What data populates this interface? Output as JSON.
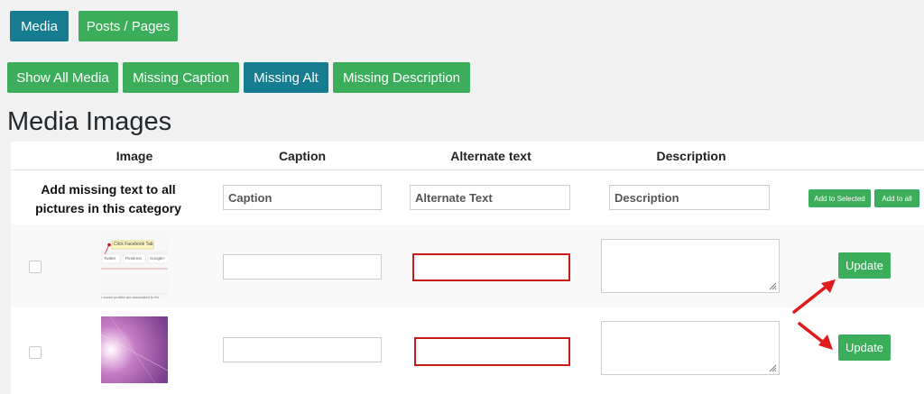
{
  "top_tabs": {
    "media": "Media",
    "posts_pages": "Posts / Pages"
  },
  "filters": {
    "show_all": "Show All Media",
    "missing_caption": "Missing Caption",
    "missing_alt": "Missing Alt",
    "missing_description": "Missing Description"
  },
  "page_title": "Media Images",
  "table": {
    "headers": {
      "image": "Image",
      "caption": "Caption",
      "alt_text": "Alternate text",
      "description": "Description"
    },
    "bulk": {
      "label": "Add missing text to all pictures in this category",
      "caption_placeholder": "Caption",
      "alt_placeholder": "Alternate Text",
      "description_placeholder": "Description",
      "add_selected": "Add to Selected",
      "add_all": "Add to all"
    },
    "rows": [
      {
        "thumb_texts": {
          "callout": "Click Facebook Tab",
          "tab1": "Twitter",
          "tab2": "Pinterest",
          "tab3": "Google+",
          "footer": "r social profiles are associated to thi"
        },
        "update": "Update"
      },
      {
        "update": "Update"
      }
    ]
  },
  "colors": {
    "teal": "#157d8f",
    "green": "#3cae5b",
    "annotation_red": "#e01b1b"
  }
}
